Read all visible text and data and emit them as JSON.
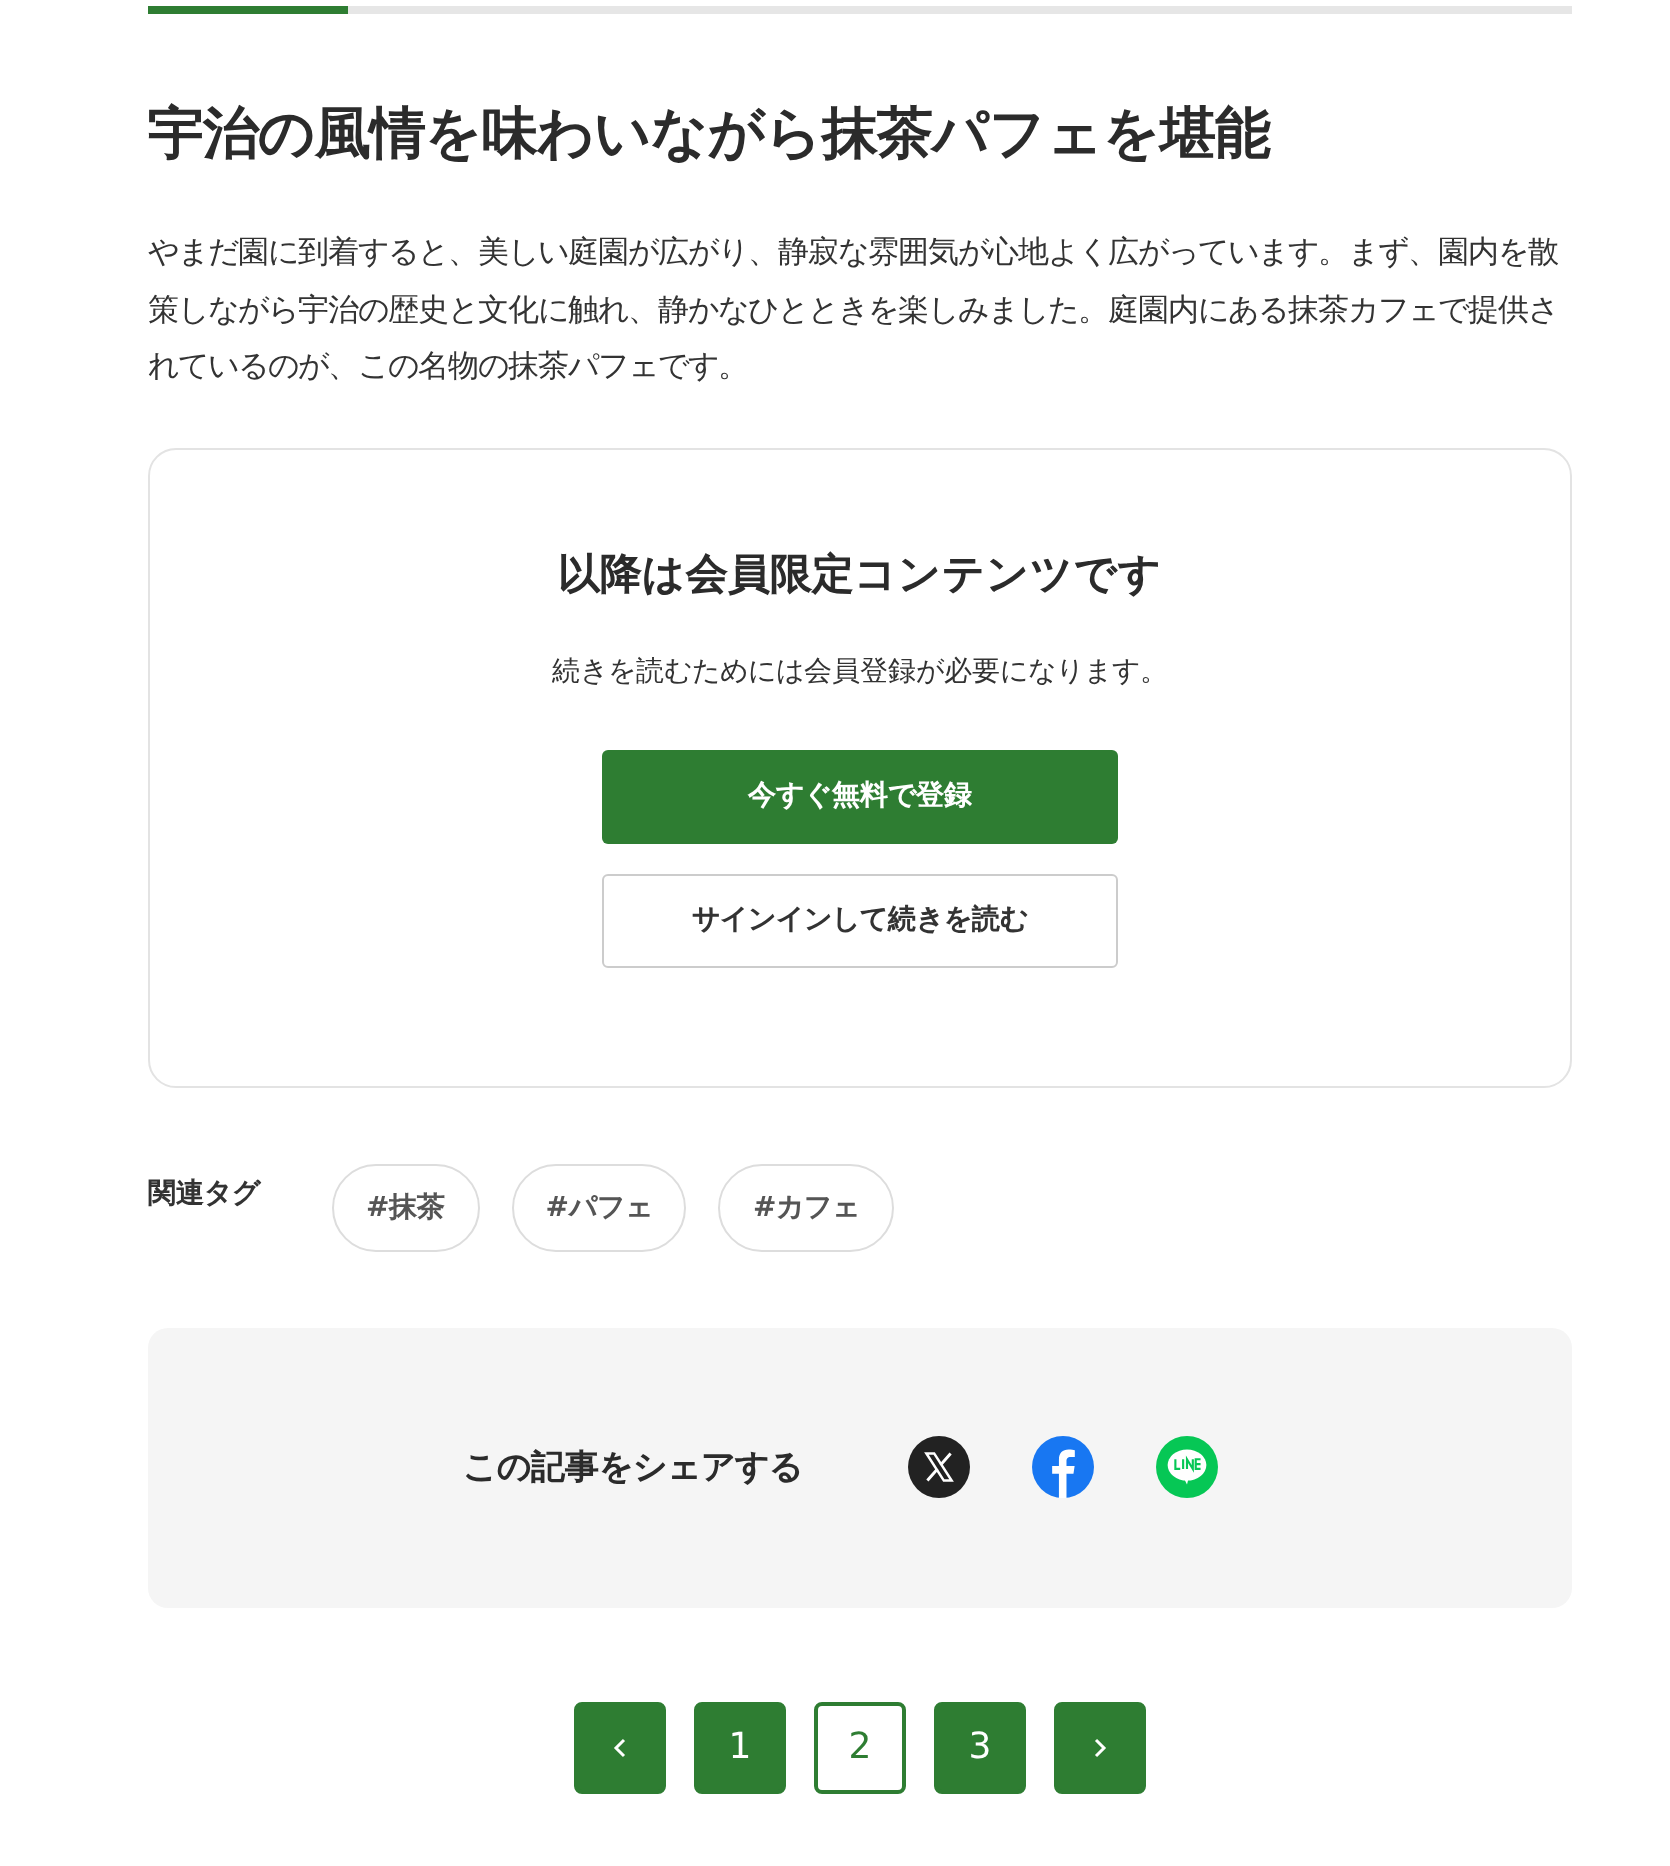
{
  "progress": {
    "level": 0.14
  },
  "article": {
    "title": "宇治の風情を味わいながら抹茶パフェを堪能",
    "body": "やまだ園に到着すると、美しい庭園が広がり、静寂な雰囲気が心地よく広がっています。まず、園内を散策しながら宇治の歴史と文化に触れ、静かなひとときを楽しみました。庭園内にある抹茶カフェで提供されているのが、この名物の抹茶パフェです。"
  },
  "paywall": {
    "heading": "以降は会員限定コンテンツです",
    "message": "続きを読むためには会員登録が必要になります。",
    "buttons": [
      {
        "label": "今すぐ無料で登録",
        "kind": "primary"
      },
      {
        "label": "サインインして続きを読む",
        "kind": "secondary"
      }
    ]
  },
  "tags": {
    "label": "関連タグ",
    "items": [
      "#抹茶",
      "#パフェ",
      "#カフェ"
    ]
  },
  "share": {
    "label": "この記事をシェアする",
    "services": [
      {
        "kind": "x"
      },
      {
        "kind": "facebook"
      },
      {
        "kind": "line"
      }
    ]
  },
  "pagination": {
    "pages": [
      {
        "label": "1",
        "selected": false
      },
      {
        "label": "2",
        "selected": true
      },
      {
        "label": "3",
        "selected": false
      }
    ]
  }
}
